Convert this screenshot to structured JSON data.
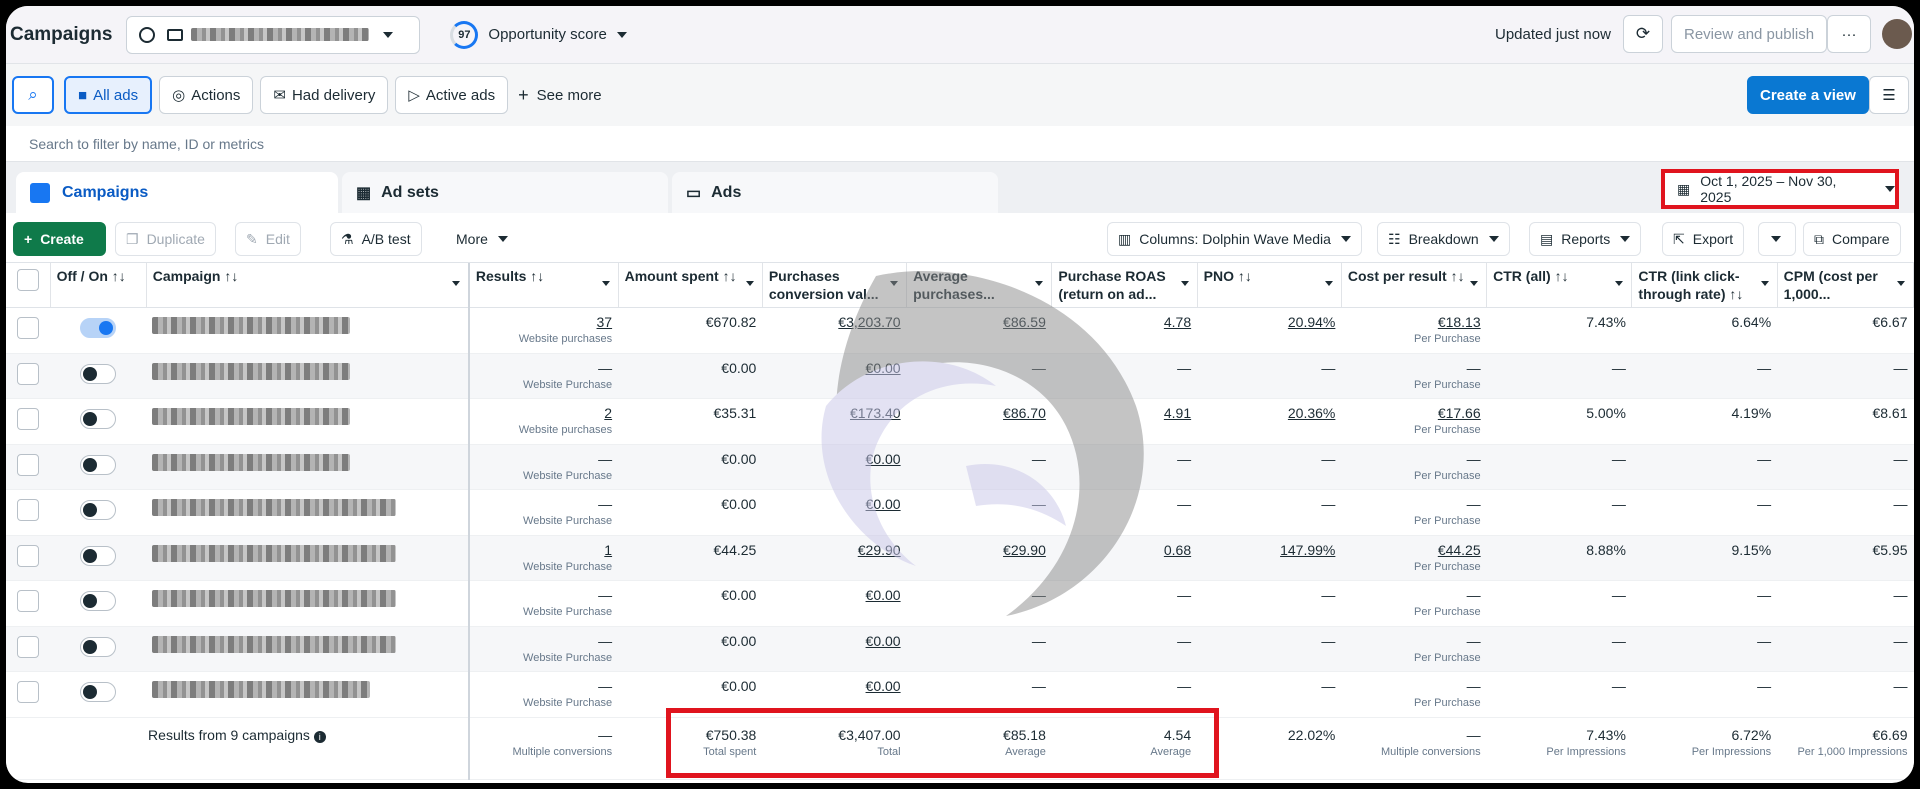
{
  "header": {
    "title": "Campaigns",
    "opportunity_score": "97",
    "opportunity_label": "Opportunity score",
    "updated": "Updated just now",
    "review_publish": "Review and publish"
  },
  "filters": [
    "All ads",
    "Actions",
    "Had delivery",
    "Active ads",
    "See more"
  ],
  "filters_right": {
    "create_view": "Create a view"
  },
  "search": {
    "placeholder": "Search to filter by name, ID or metrics"
  },
  "tabs": [
    "Campaigns",
    "Ad sets",
    "Ads"
  ],
  "date_range": "Oct 1, 2025 – Nov 30, 2025",
  "toolbar": {
    "create": "Create",
    "duplicate": "Duplicate",
    "edit": "Edit",
    "ab_test": "A/B test",
    "more": "More",
    "columns": "Columns: Dolphin Wave Media",
    "breakdown": "Breakdown",
    "reports": "Reports",
    "export": "Export",
    "compare": "Compare"
  },
  "columns": [
    "Off / On ↑↓",
    "Campaign ↑↓",
    "Results ↑↓",
    "Amount spent ↑↓",
    "Purchases conversion val...",
    "Average purchases...",
    "Purchase ROAS (return on ad...",
    "PNO ↑↓",
    "Cost per result ↑↓",
    "CTR (all) ↑↓",
    "CTR (link click-through rate) ↑↓",
    "CPM (cost per 1,000..."
  ],
  "rows": [
    {
      "on": true,
      "name_width": 198,
      "results": "37",
      "results_sub": "Website purchases",
      "spent": "€670.82",
      "conv_value": "€3,203.70",
      "avg_value": "€86.59",
      "roas": "4.78",
      "pno": "20.94%",
      "cpr": "€18.13",
      "cpr_sub": "Per Purchase",
      "ctr": "7.43%",
      "ctr_link": "6.64%",
      "cpm": "€6.67"
    },
    {
      "on": false,
      "name_width": 198,
      "results": "—",
      "results_sub": "Website Purchase",
      "spent": "€0.00",
      "conv_value": "€0.00",
      "avg_value": "—",
      "roas": "—",
      "pno": "—",
      "cpr": "—",
      "cpr_sub": "Per Purchase",
      "ctr": "—",
      "ctr_link": "—",
      "cpm": "—"
    },
    {
      "on": false,
      "name_width": 198,
      "results": "2",
      "results_sub": "Website purchases",
      "spent": "€35.31",
      "conv_value": "€173.40",
      "avg_value": "€86.70",
      "roas": "4.91",
      "pno": "20.36%",
      "cpr": "€17.66",
      "cpr_sub": "Per Purchase",
      "ctr": "5.00%",
      "ctr_link": "4.19%",
      "cpm": "€8.61"
    },
    {
      "on": false,
      "name_width": 198,
      "results": "—",
      "results_sub": "Website Purchase",
      "spent": "€0.00",
      "conv_value": "€0.00",
      "avg_value": "—",
      "roas": "—",
      "pno": "—",
      "cpr": "—",
      "cpr_sub": "Per Purchase",
      "ctr": "—",
      "ctr_link": "—",
      "cpm": "—"
    },
    {
      "on": false,
      "name_width": 244,
      "results": "—",
      "results_sub": "Website Purchase",
      "spent": "€0.00",
      "conv_value": "€0.00",
      "avg_value": "—",
      "roas": "—",
      "pno": "—",
      "cpr": "—",
      "cpr_sub": "Per Purchase",
      "ctr": "—",
      "ctr_link": "—",
      "cpm": "—"
    },
    {
      "on": false,
      "name_width": 244,
      "results": "1",
      "results_sub": "Website Purchase",
      "spent": "€44.25",
      "conv_value": "€29.90",
      "avg_value": "€29.90",
      "roas": "0.68",
      "pno": "147.99%",
      "cpr": "€44.25",
      "cpr_sub": "Per Purchase",
      "ctr": "8.88%",
      "ctr_link": "9.15%",
      "cpm": "€5.95"
    },
    {
      "on": false,
      "name_width": 244,
      "results": "—",
      "results_sub": "Website Purchase",
      "spent": "€0.00",
      "conv_value": "€0.00",
      "avg_value": "—",
      "roas": "—",
      "pno": "—",
      "cpr": "—",
      "cpr_sub": "Per Purchase",
      "ctr": "—",
      "ctr_link": "—",
      "cpm": "—"
    },
    {
      "on": false,
      "name_width": 244,
      "results": "—",
      "results_sub": "Website Purchase",
      "spent": "€0.00",
      "conv_value": "€0.00",
      "avg_value": "—",
      "roas": "—",
      "pno": "—",
      "cpr": "—",
      "cpr_sub": "Per Purchase",
      "ctr": "—",
      "ctr_link": "—",
      "cpm": "—"
    },
    {
      "on": false,
      "name_width": 218,
      "results": "—",
      "results_sub": "Website Purchase",
      "spent": "€0.00",
      "conv_value": "€0.00",
      "avg_value": "—",
      "roas": "—",
      "pno": "—",
      "cpr": "—",
      "cpr_sub": "Per Purchase",
      "ctr": "—",
      "ctr_link": "—",
      "cpm": "—"
    }
  ],
  "totals": {
    "label": "Results from 9 campaigns",
    "results": "—",
    "results_sub": "Multiple conversions",
    "spent": "€750.38",
    "spent_sub": "Total spent",
    "conv_value": "€3,407.00",
    "conv_value_sub": "Total",
    "avg_value": "€85.18",
    "avg_value_sub": "Average",
    "roas": "4.54",
    "roas_sub": "Average",
    "pno": "22.02%",
    "cpr": "—",
    "cpr_sub": "Multiple conversions",
    "ctr": "7.43%",
    "ctr_sub": "Per Impressions",
    "ctr_link": "6.72%",
    "ctr_link_sub": "Per Impressions",
    "cpm": "€6.69",
    "cpm_sub": "Per 1,000 Impressions"
  }
}
